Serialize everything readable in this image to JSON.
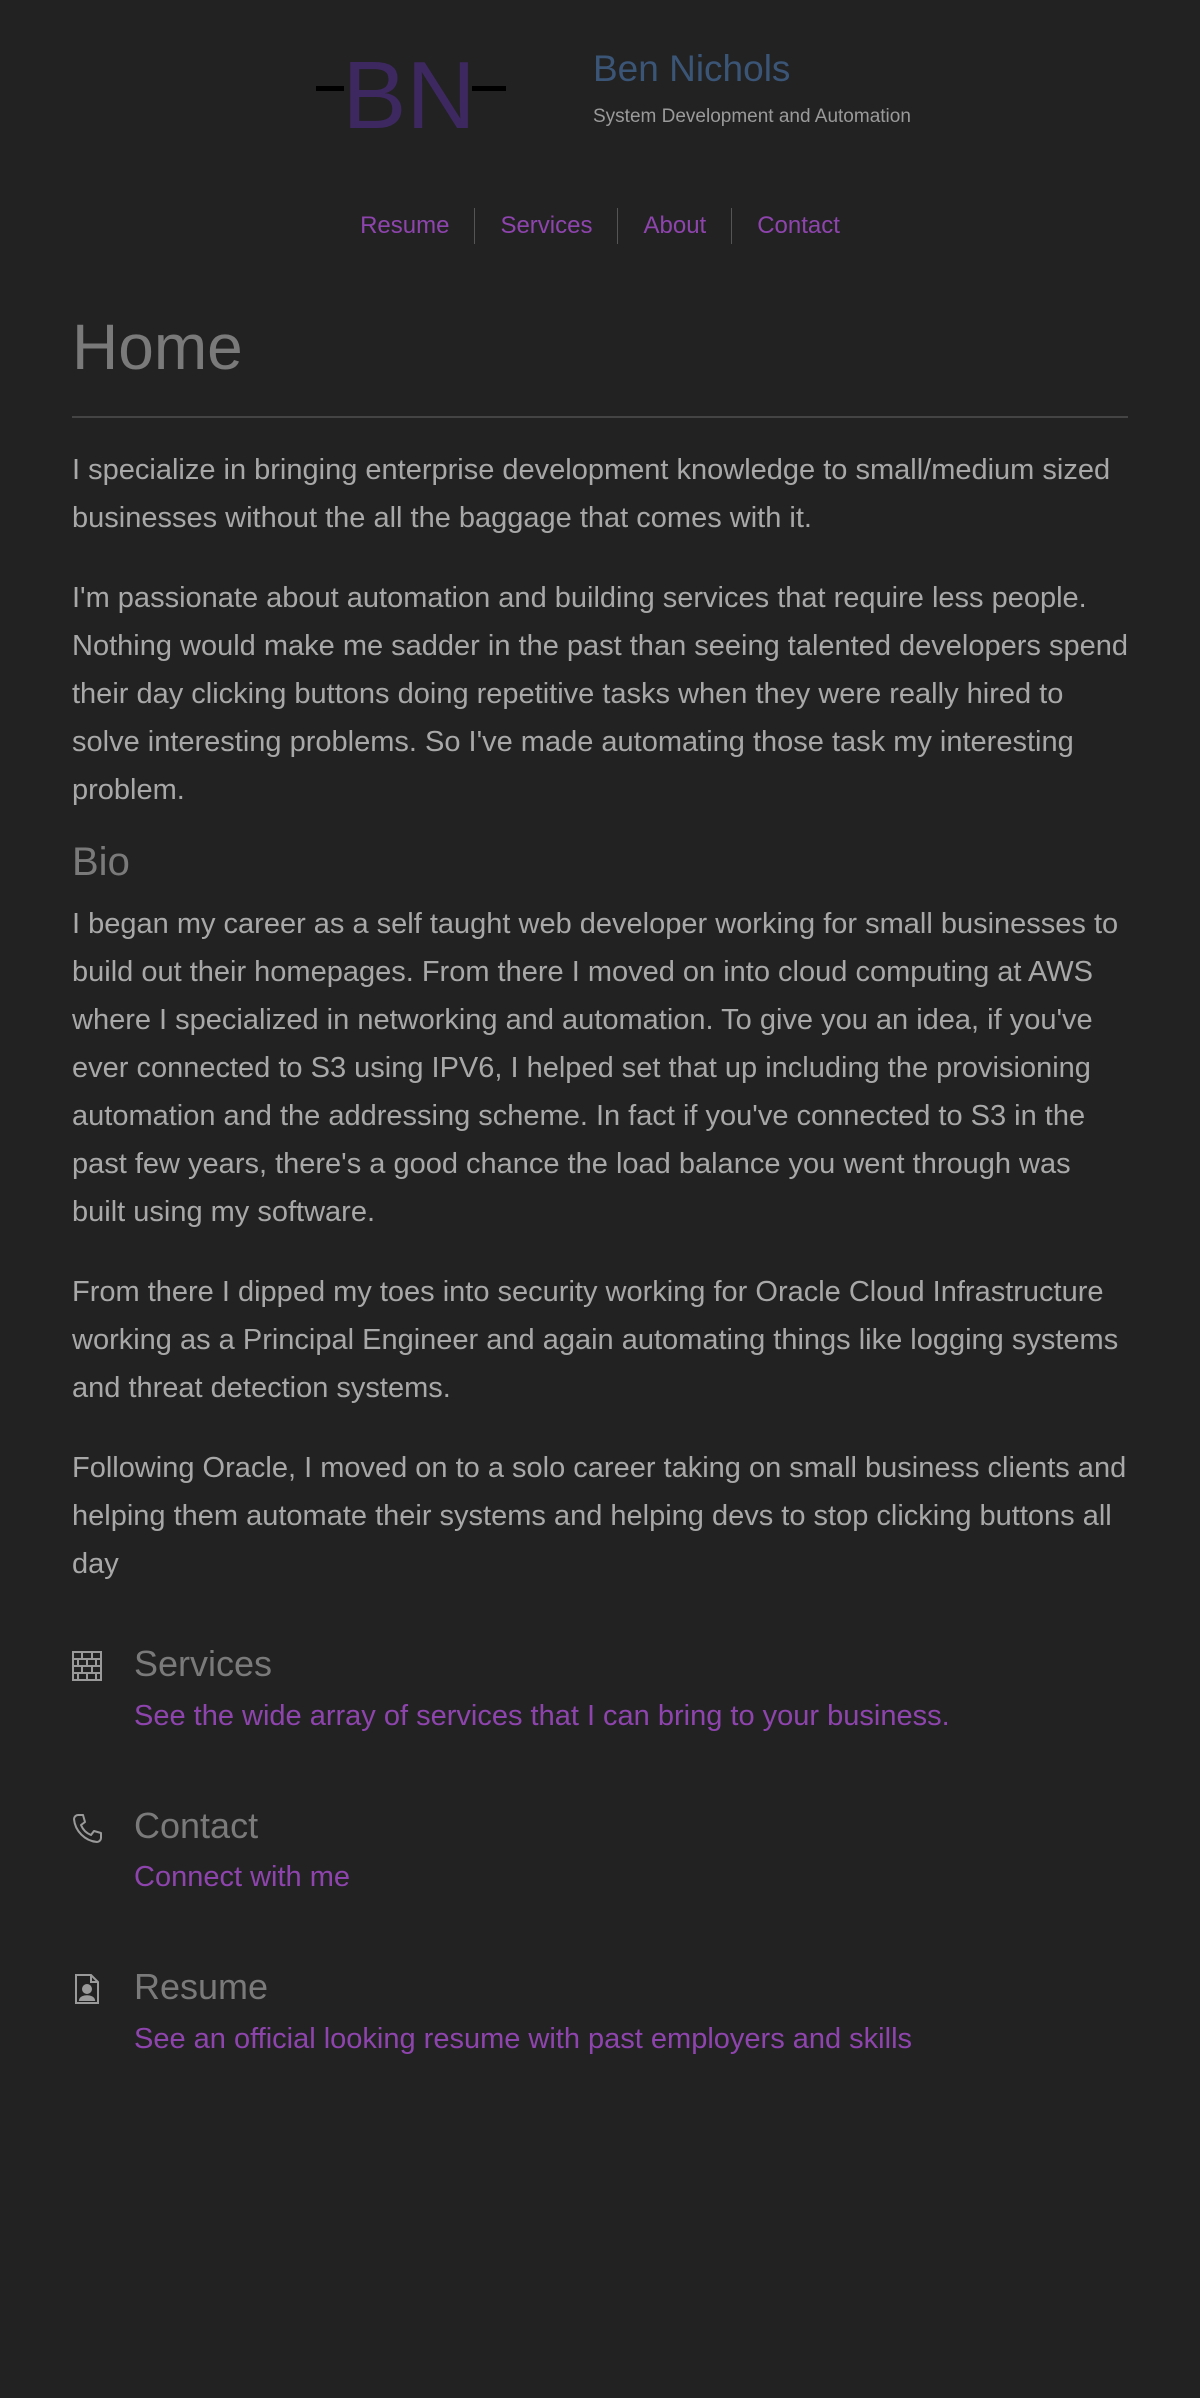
{
  "brand": {
    "name": "Ben Nichols",
    "tagline": "System Development and Automation",
    "logo_letters": "BN",
    "colors": {
      "title": "#3b5577",
      "accent": "#8e44ad",
      "logo": "#3d2860",
      "background": "#222222"
    }
  },
  "nav": {
    "items": [
      {
        "label": "Resume"
      },
      {
        "label": "Services"
      },
      {
        "label": "About"
      },
      {
        "label": "Contact"
      }
    ]
  },
  "main": {
    "title": "Home",
    "intro": [
      "I specialize in bringing enterprise development knowledge to small/medium sized businesses without the all the baggage that comes with it.",
      "I'm passionate about automation and building services that require less people. Nothing would make me sadder in the past than seeing talented developers spend their day clicking buttons doing repetitive tasks when they were really hired to solve interesting problems. So I've made automating those task my interesting problem."
    ],
    "bio_title": "Bio",
    "bio": [
      "I began my career as a self taught web developer working for small businesses to build out their homepages. From there I moved on into cloud computing at AWS where I specialized in networking and automation. To give you an idea, if you've ever connected to S3 using IPV6, I helped set that up including the provisioning automation and the addressing scheme. In fact if you've connected to S3 in the past few years, there's a good chance the load balance you went through was built using my software.",
      "From there I dipped my toes into security working for Oracle Cloud Infrastructure working as a Principal Engineer and again automating things like logging systems and threat detection systems.",
      "Following Oracle, I moved on to a solo career taking on small business clients and helping them automate their systems and helping devs to stop clicking buttons all day"
    ]
  },
  "features": [
    {
      "icon": "brick-wall-icon",
      "title": "Services",
      "link": "See the wide array of services that I can bring to your business."
    },
    {
      "icon": "phone-icon",
      "title": "Contact",
      "link": "Connect with me"
    },
    {
      "icon": "resume-file-icon",
      "title": "Resume",
      "link": "See an official looking resume with past employers and skills"
    }
  ]
}
